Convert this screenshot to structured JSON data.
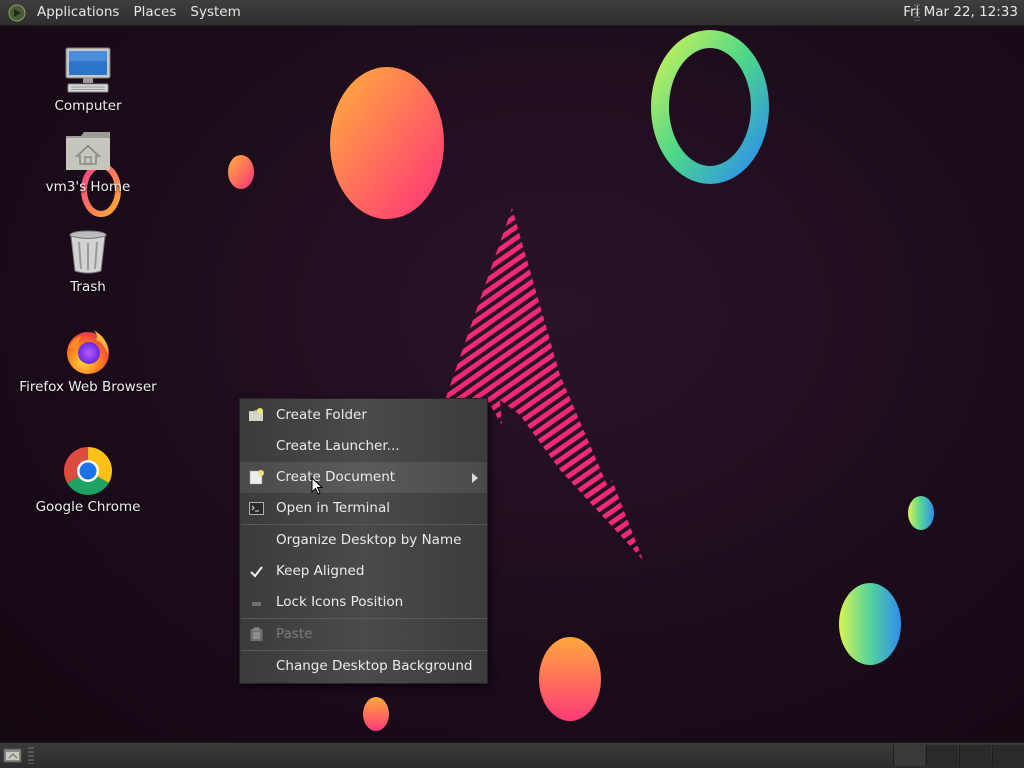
{
  "top_panel": {
    "menus": [
      "Applications",
      "Places",
      "System"
    ],
    "clock": "Fri Mar 22, 12:33"
  },
  "desktop": {
    "icons": [
      {
        "label": "Computer",
        "icon": "computer-icon"
      },
      {
        "label": "vm3's Home",
        "icon": "home-folder-icon"
      },
      {
        "label": "Trash",
        "icon": "trash-icon"
      },
      {
        "label": "Firefox Web Browser",
        "icon": "firefox-icon"
      },
      {
        "label": "Google Chrome",
        "icon": "chrome-icon"
      }
    ]
  },
  "context_menu": {
    "items": [
      {
        "label": "Create Folder",
        "icon": "new-folder-icon"
      },
      {
        "label": "Create Launcher...",
        "icon": ""
      },
      {
        "label": "Create Document",
        "icon": "new-document-icon",
        "submenu": true,
        "highlighted": true
      },
      {
        "label": "Open in Terminal",
        "icon": "terminal-icon"
      },
      {
        "label": "Organize Desktop by Name",
        "icon": ""
      },
      {
        "label": "Keep Aligned",
        "icon": "checkmark-icon",
        "checked": true
      },
      {
        "label": "Lock Icons Position",
        "icon": "lock-toggle-icon"
      },
      {
        "label": "Paste",
        "icon": "paste-icon",
        "disabled": true
      },
      {
        "label": "Change Desktop Background",
        "icon": ""
      }
    ]
  },
  "bottom_panel": {
    "workspace_count": 4,
    "icon": "show-desktop-icon"
  }
}
